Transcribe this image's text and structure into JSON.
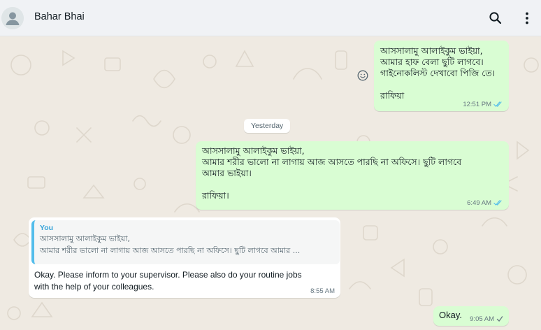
{
  "header": {
    "contact_name": "Bahar Bhai",
    "avatar_icon": "default-avatar-icon",
    "search_icon": "search-icon",
    "menu_icon": "kebab-menu-icon"
  },
  "colors": {
    "header_bg": "#f0f2f5",
    "chat_bg": "#efeae2",
    "outgoing_bubble": "#d9fdd3",
    "incoming_bubble": "#ffffff",
    "read_tick": "#53bdeb",
    "quote_accent": "#53bdeb"
  },
  "messages": [
    {
      "direction": "out",
      "text": "আসসালামু আলাইকুম ভাইয়া,\nআমার হাফ বেলা ছুটি লাগবে।\nগাইনোকলিস্ট দেখাবো পিজি তে।\n\nরাফিয়া",
      "time": "12:51 PM",
      "status": "read"
    },
    {
      "direction": "out",
      "text": "আসসালামু আলাইকুম ভাইয়া,\nআমার শরীর ভালো না লাগায় আজ আসতে পারছি না অফিসে। ছুটি লাগবে\nআমার ভাইয়া।\n\nরাফিয়া।",
      "time": "6:49 AM",
      "status": "read"
    },
    {
      "direction": "in",
      "quote_author": "You",
      "quote_text": "আসসালামু আলাইকুম ভাইয়া,\nআমার শরীর ভালো না লাগায় আজ আসতে পারছি না অফিসে। ছুটি লাগবে আমার ...",
      "text": "Okay.  Please inform to your supervisor.  Please also do your routine jobs\nwith the help of your colleagues.",
      "time": "8:55 AM"
    },
    {
      "direction": "out",
      "text": "Okay.",
      "time": "9:05 AM",
      "status": "delivered"
    }
  ],
  "date_separator": "Yesterday",
  "reaction_icon": "emoji-smiley-icon"
}
